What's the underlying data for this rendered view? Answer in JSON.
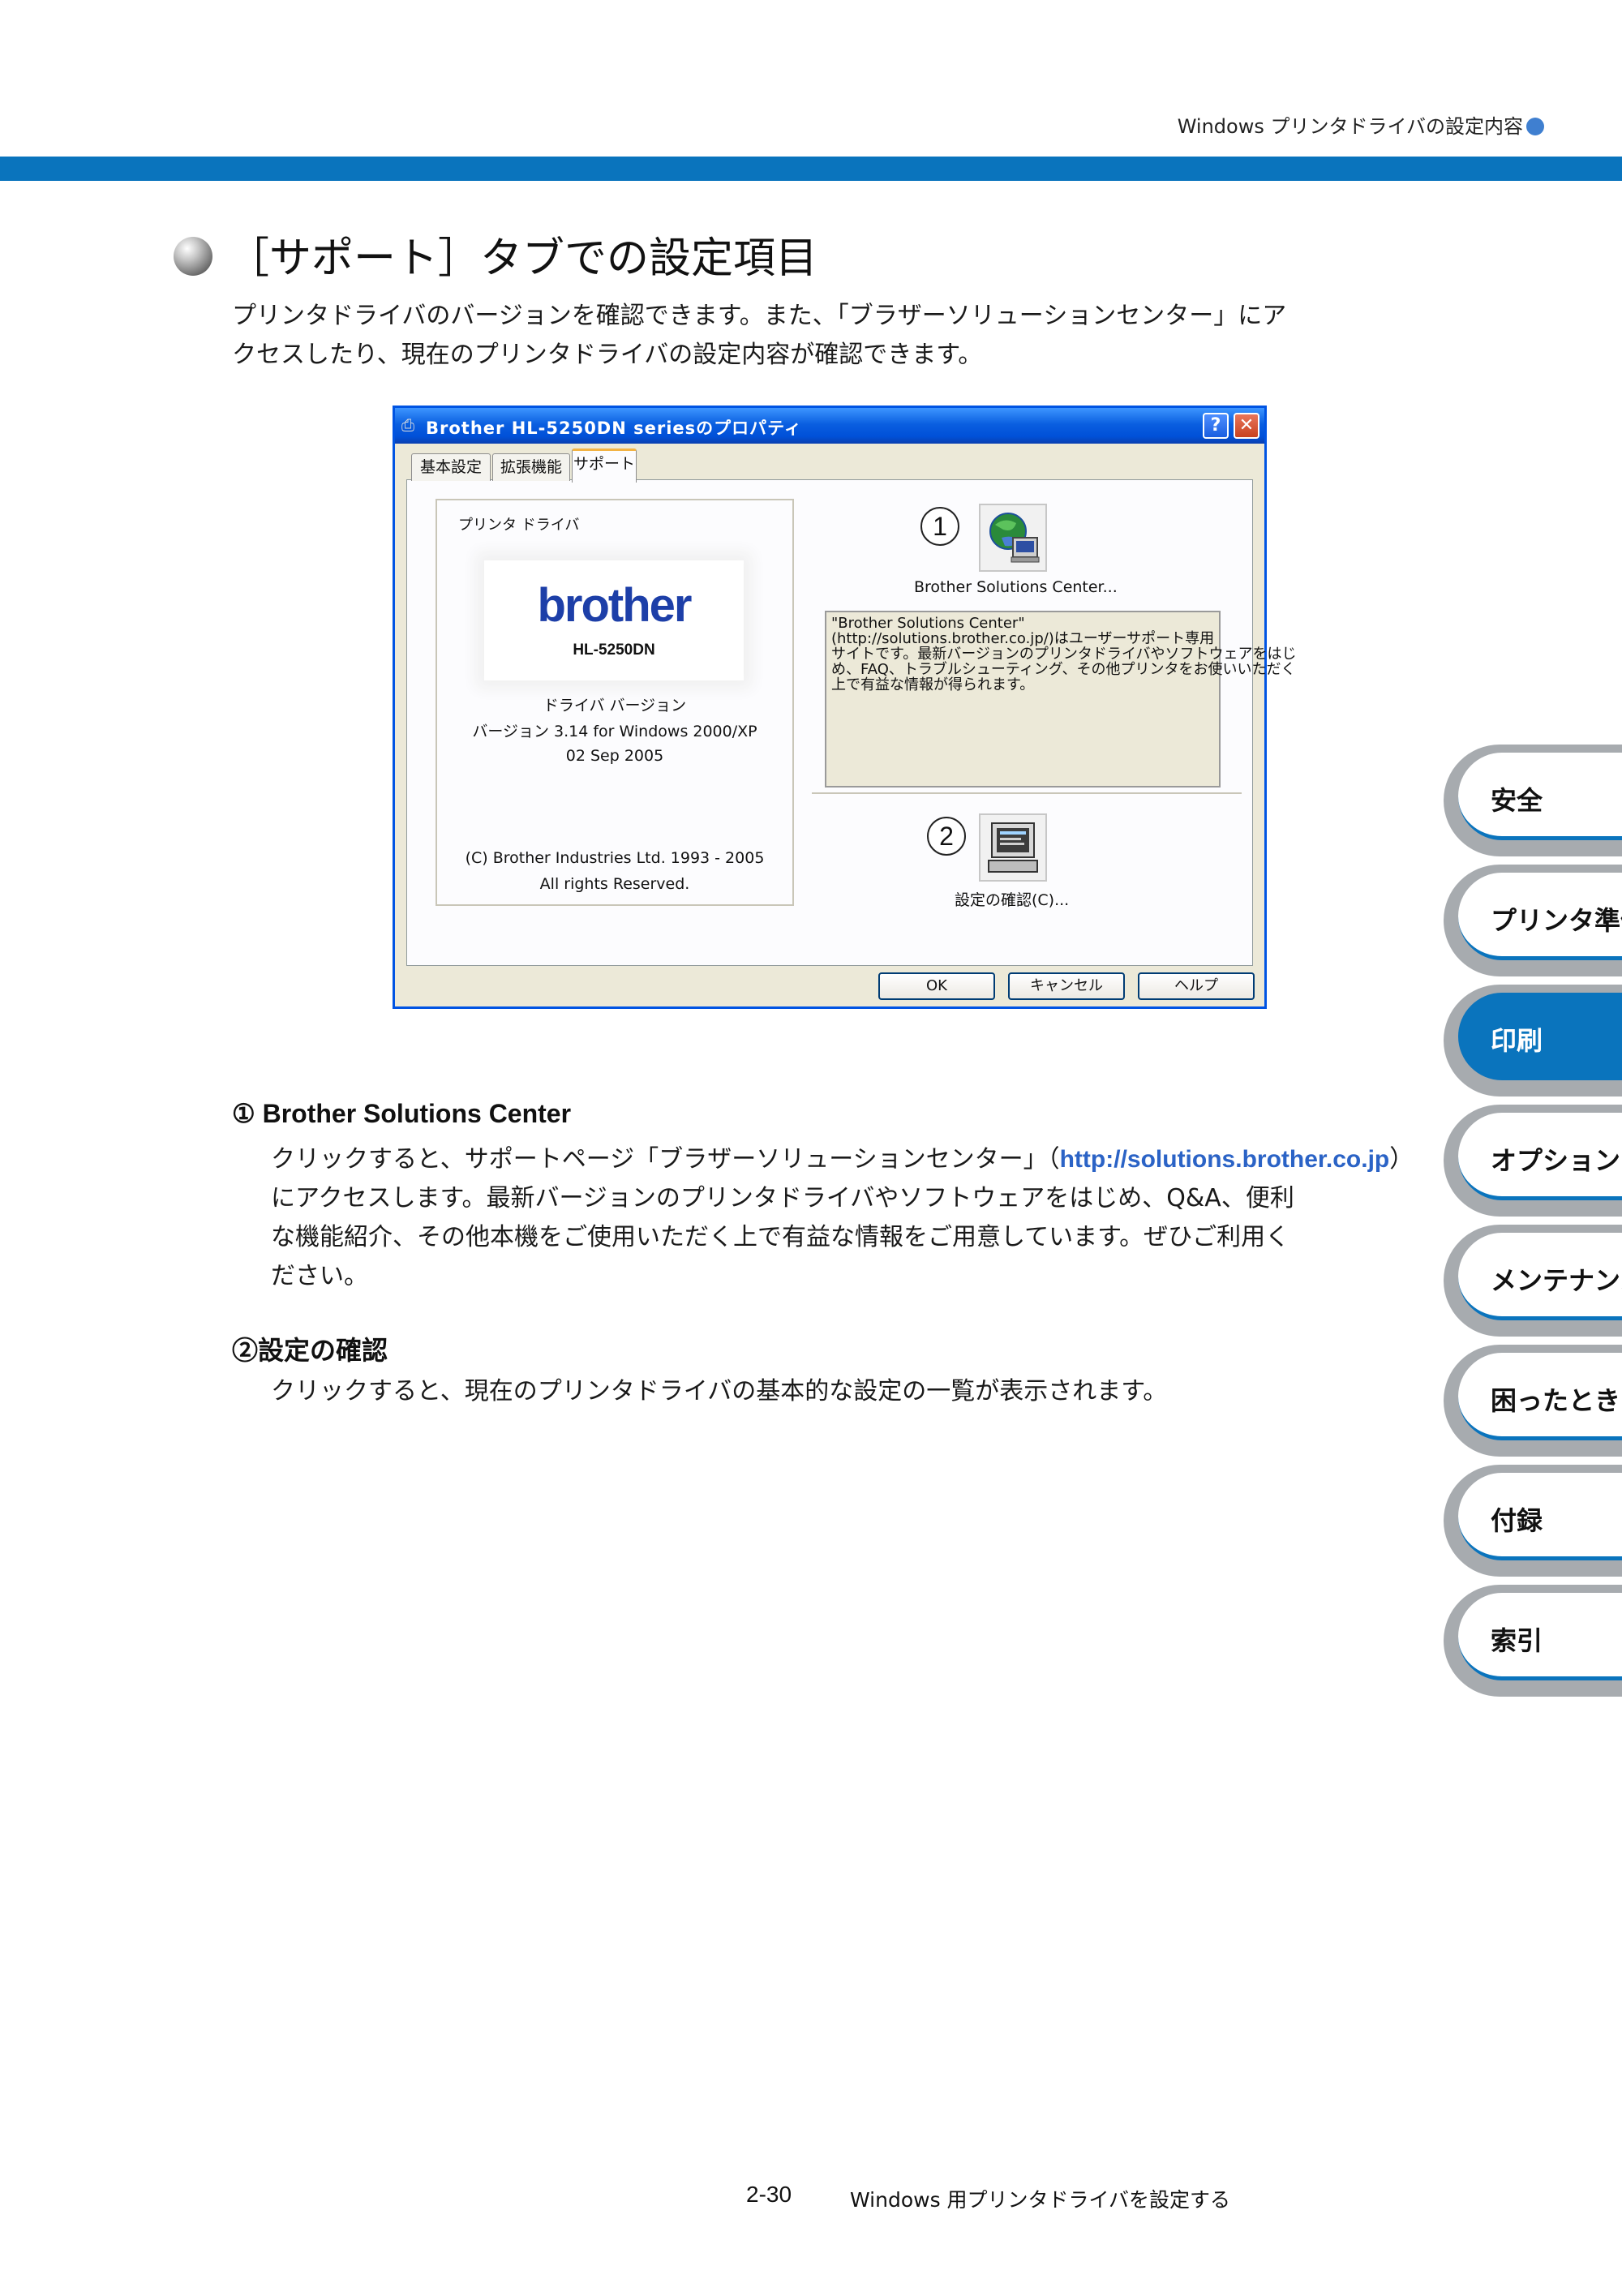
{
  "header": {
    "title": "Windows プリンタドライバの設定内容"
  },
  "section": {
    "title": "［サポート］タブでの設定項目",
    "intro_lines": [
      "プリンタドライバのバージョンを確認できます。また、「ブラザーソリューションセンター」にア",
      "クセスしたり、現在のプリンタドライバの設定内容が確認できます。"
    ]
  },
  "dialog": {
    "title": "Brother HL-5250DN seriesのプロパティ",
    "help_button": "?",
    "close_button": "✕",
    "tabs": [
      "基本設定",
      "拡張機能",
      "サポート"
    ],
    "driver_label": "プリンタ ドライバ",
    "logo_brand": "brother",
    "logo_model": "HL-5250DN",
    "driver_version_label": "ドライバ バージョン",
    "version_line": "バージョン 3.14 for Windows 2000/XP",
    "date": "02 Sep 2005",
    "copyright_1": "(C) Brother Industries Ltd. 1993 - 2005",
    "copyright_2": "All rights Reserved.",
    "callout_1": "1",
    "callout_2": "2",
    "bsc_button_label": "Brother Solutions Center...",
    "description_lines": [
      "\"Brother Solutions Center\"",
      "(http://solutions.brother.co.jp/)はユーザーサポート専用",
      "サイトです。最新バージョンのプリンタドライバやソフトウェアをはじ",
      "め、FAQ、トラブルシューティング、その他プリンタをお使いいただく",
      "上で有益な情報が得られます。"
    ],
    "settings_button_label": "設定の確認(C)...",
    "ok": "OK",
    "cancel": "キャンセル",
    "help": "ヘルプ"
  },
  "items": [
    {
      "heading": "① Brother Solutions Center",
      "line1_pre": "クリックすると、サポートページ「ブラザーソリューションセンター」（",
      "link": "http://solutions.brother.co.jp",
      "line1_post": "）",
      "lines": [
        "にアクセスします。最新バージョンのプリンタドライバやソフトウェアをはじめ、Q&A、便利",
        "な機能紹介、その他本機をご使用いただく上で有益な情報をご用意しています。ぜひご利用く",
        "ださい。"
      ]
    },
    {
      "heading": "②設定の確認",
      "lines": [
        "クリックすると、現在のプリンタドライバの基本的な設定の一覧が表示されます。"
      ]
    }
  ],
  "side_tabs": [
    "安全",
    "プリンタ準備",
    "印刷",
    "オプション",
    "メンテナンス",
    "困ったときは",
    "付録",
    "索引"
  ],
  "active_side_tab": "印刷",
  "footer": {
    "page": "2-30",
    "title": "Windows 用プリンタドライバを設定する"
  },
  "colors": {
    "accent": "#0a74bd",
    "link": "#2b63c6"
  }
}
